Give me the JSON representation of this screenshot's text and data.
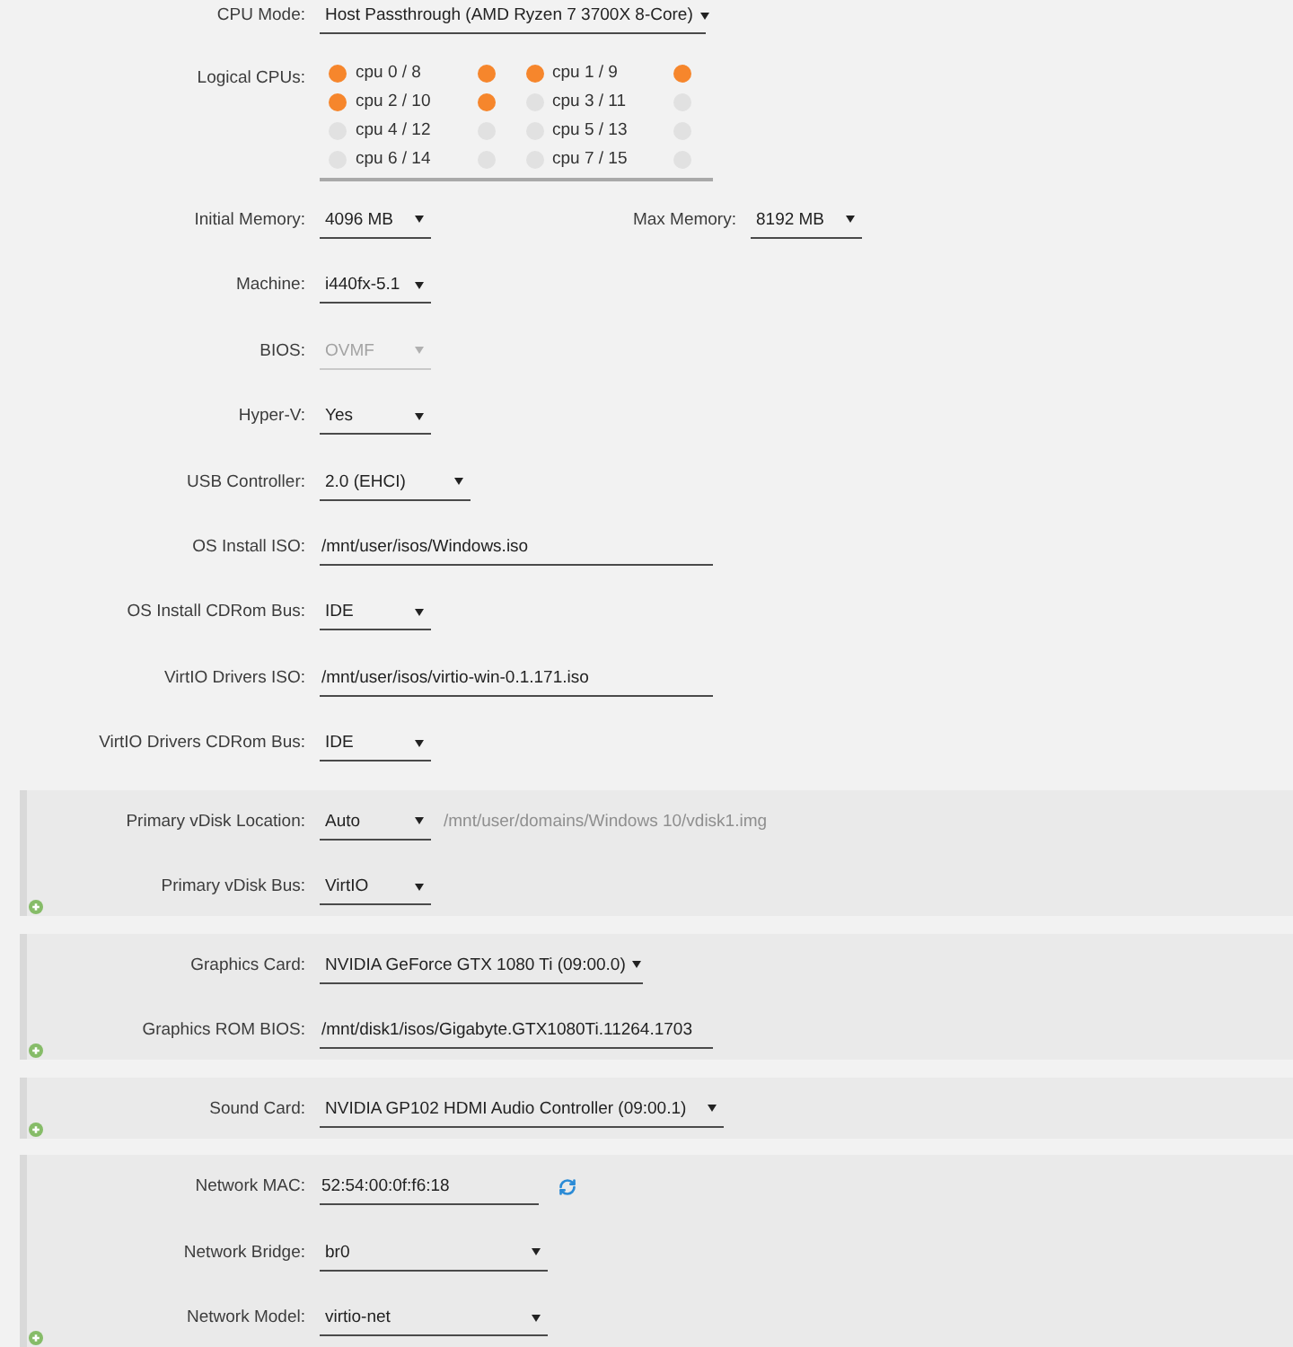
{
  "main_fields": [
    {
      "kind": "select",
      "label": "CPU Mode:",
      "value": "Host Passthrough (AMD Ryzen 7 3700X 8-Core)",
      "disabled": false
    },
    {
      "kind": "cpus",
      "label": "Logical CPUs:",
      "cpus": [
        {
          "label": "cpu 0 / 8",
          "threads": [
            {
              "checked": true
            },
            {
              "checked": true
            }
          ]
        },
        {
          "label": "cpu 1 / 9",
          "threads": [
            {
              "checked": true
            },
            {
              "checked": true
            }
          ]
        },
        {
          "label": "cpu 2 / 10",
          "threads": [
            {
              "checked": true
            },
            {
              "checked": true
            }
          ]
        },
        {
          "label": "cpu 3 / 11",
          "threads": [
            {
              "checked": false
            },
            {
              "checked": false
            }
          ]
        },
        {
          "label": "cpu 4 / 12",
          "threads": [
            {
              "checked": false
            },
            {
              "checked": false
            }
          ]
        },
        {
          "label": "cpu 5 / 13",
          "threads": [
            {
              "checked": false
            },
            {
              "checked": false
            }
          ]
        },
        {
          "label": "cpu 6 / 14",
          "threads": [
            {
              "checked": false
            },
            {
              "checked": false
            }
          ]
        },
        {
          "label": "cpu 7 / 15",
          "threads": [
            {
              "checked": false
            },
            {
              "checked": false
            }
          ]
        }
      ]
    },
    {
      "kind": "select",
      "label": "Initial Memory:",
      "value": "4096 MB",
      "disabled": false,
      "paired": {
        "label": "Max Memory:",
        "value": "8192 MB",
        "disabled": false
      }
    },
    {
      "kind": "select",
      "label": "Machine:",
      "value": "i440fx-5.1",
      "disabled": false
    },
    {
      "kind": "select",
      "label": "BIOS:",
      "value": "OVMF",
      "disabled": true
    },
    {
      "kind": "select",
      "label": "Hyper-V:",
      "value": "Yes",
      "disabled": false
    },
    {
      "kind": "select",
      "label": "USB Controller:",
      "value": "2.0 (EHCI)",
      "disabled": false
    },
    {
      "kind": "text",
      "label": "OS Install ISO:",
      "value": "/mnt/user/isos/Windows.iso"
    },
    {
      "kind": "select",
      "label": "OS Install CDRom Bus:",
      "value": "IDE",
      "disabled": false
    },
    {
      "kind": "text",
      "label": "VirtIO Drivers ISO:",
      "value": "/mnt/user/isos/virtio-win-0.1.171.iso"
    },
    {
      "kind": "select",
      "label": "VirtIO Drivers CDRom Bus:",
      "value": "IDE",
      "disabled": false
    }
  ],
  "sections": [
    {
      "fields": [
        {
          "kind": "select",
          "label": "Primary vDisk Location:",
          "value": "Auto",
          "disabled": false,
          "path": {
            "value": "/mnt/user/domains/Windows 10/vdisk1.img",
            "disabled": true
          }
        },
        {
          "kind": "select",
          "label": "Primary vDisk Bus:",
          "value": "VirtIO",
          "disabled": false
        }
      ]
    },
    {
      "fields": [
        {
          "kind": "select",
          "label": "Graphics Card:",
          "value": "NVIDIA GeForce GTX 1080 Ti (09:00.0)",
          "disabled": false
        },
        {
          "kind": "text",
          "label": "Graphics ROM BIOS:",
          "value": "/mnt/disk1/isos/Gigabyte.GTX1080Ti.11264.1703"
        }
      ]
    },
    {
      "fields": [
        {
          "kind": "select",
          "label": "Sound Card:",
          "value": "NVIDIA GP102 HDMI Audio Controller (09:00.1)",
          "disabled": false
        }
      ]
    },
    {
      "fields": [
        {
          "kind": "mac",
          "label": "Network MAC:",
          "value": "52:54:00:0f:f6:18"
        },
        {
          "kind": "select",
          "label": "Network Bridge:",
          "value": "br0",
          "disabled": false
        },
        {
          "kind": "select",
          "label": "Network Model:",
          "value": "virtio-net",
          "disabled": false
        }
      ]
    }
  ]
}
